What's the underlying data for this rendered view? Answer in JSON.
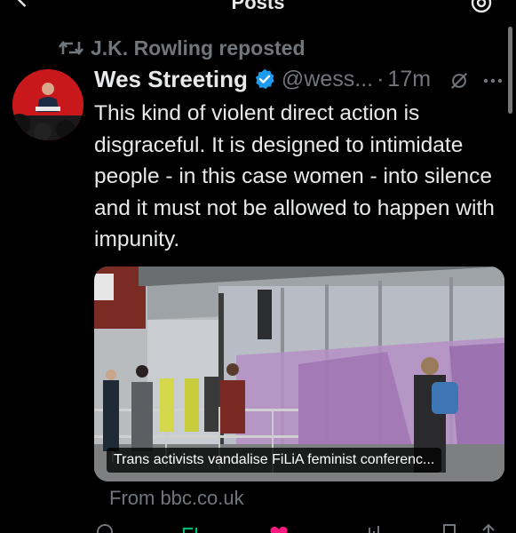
{
  "topbar": {
    "title": "Posts"
  },
  "repost": {
    "text": "J.K. Rowling reposted"
  },
  "tweet": {
    "display_name": "Wes Streeting",
    "handle": "@wess...",
    "separator": "·",
    "time": "17m",
    "text": "This kind of violent direct action is disgraceful. It is designed to intimidate people - in this case women - into silence and it must not be allowed to happen with impunity."
  },
  "card": {
    "caption": "Trans activists vandalise FiLiA feminist conferenc...",
    "source": "From bbc.co.uk"
  },
  "icons": {
    "back": "chevron-left-icon",
    "settings": "gear-icon",
    "repost": "repost-icon",
    "verified": "verified-badge-icon",
    "grok": "grok-icon",
    "more": "more-icon"
  },
  "colors": {
    "background": "#000000",
    "text": "#e7e9ea",
    "muted": "#71767b",
    "verified": "#1d9bf0",
    "repost_green": "#00ba7c",
    "like_pink": "#f91880"
  }
}
